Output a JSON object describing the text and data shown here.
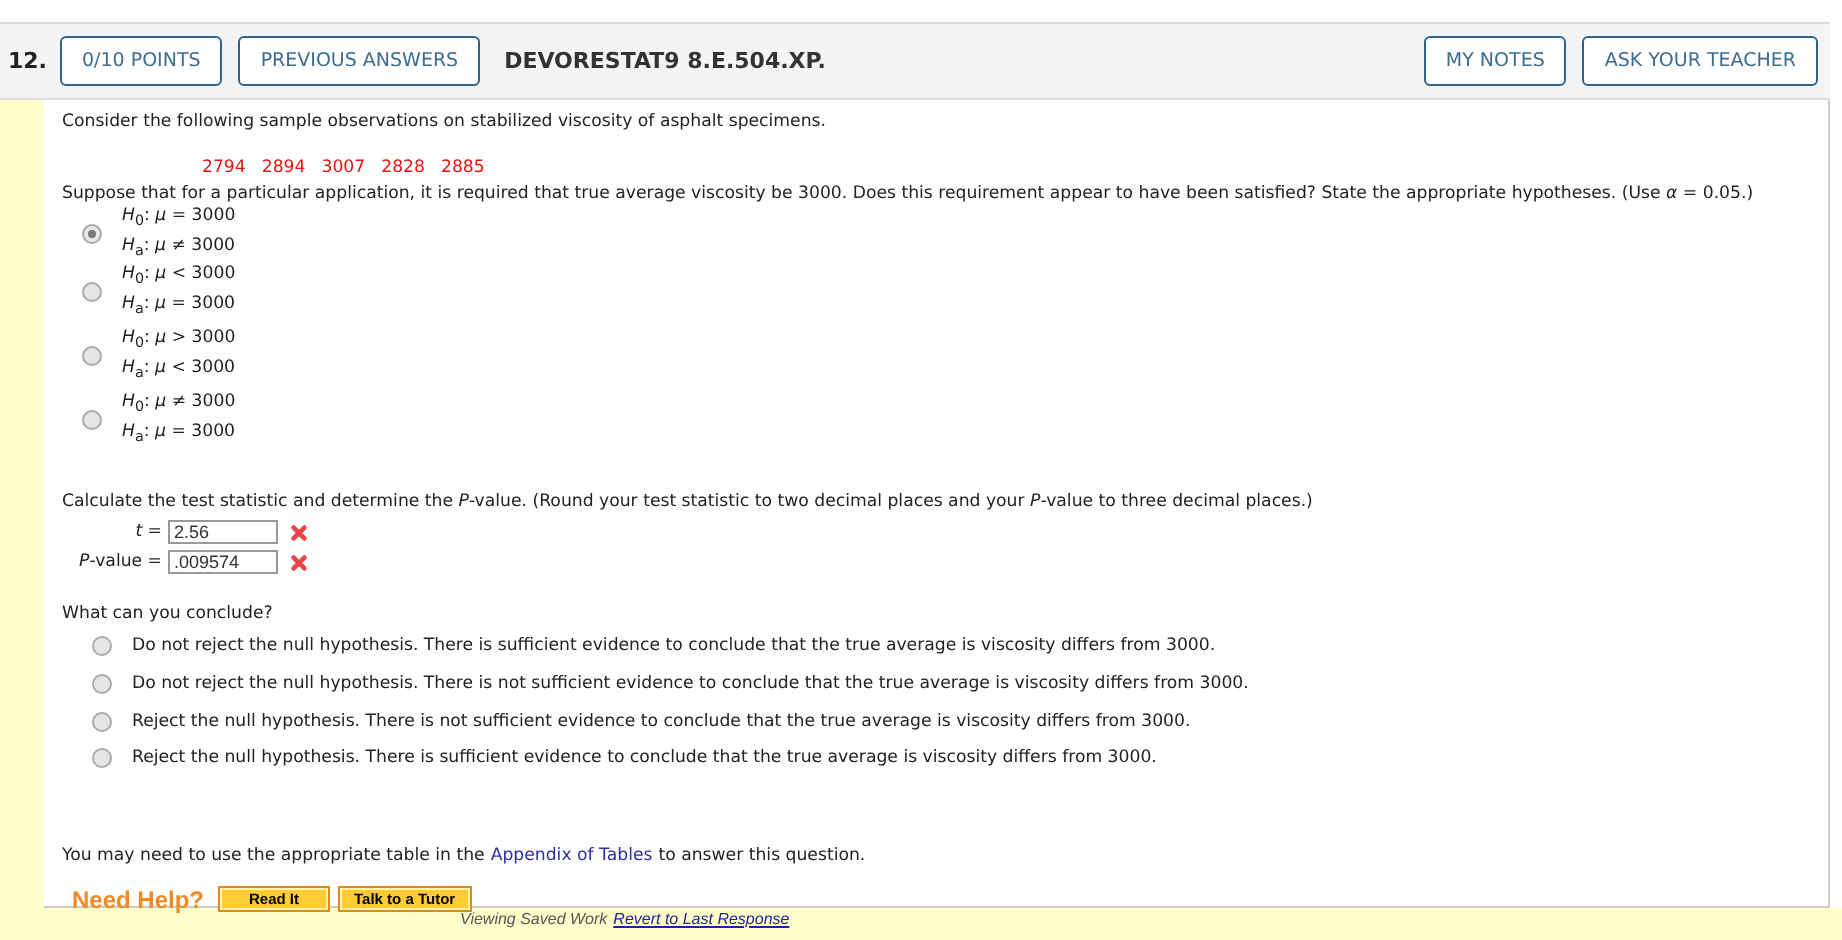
{
  "question": {
    "number": "12.",
    "points": "0/10 POINTS",
    "previous_answers": "PREVIOUS ANSWERS",
    "code": "DEVORESTAT9 8.E.504.XP.",
    "buttons": [
      "MY NOTES",
      "ASK YOUR TEACHER"
    ]
  },
  "intro": "Consider the following sample observations on stabilized viscosity of asphalt specimens.",
  "observations": [
    "2794",
    "2894",
    "3007",
    "2828",
    "2885"
  ],
  "prompt": "Suppose that for a particular application, it is required that true average viscosity be 3000. Does this requirement appear to have been satisfied? State the appropriate hypotheses. (Use *α* = 0.05.)",
  "hypothesis_options": [
    {
      "lines": [
        "*H*$_{0}$: *μ* = 3000",
        "*H*$_{a}$: *μ* ≠ 3000"
      ],
      "selected": true
    },
    {
      "lines": [
        "*H*$_{0}$: *μ* < 3000",
        "*H*$_{a}$: *μ* = 3000"
      ],
      "selected": false
    },
    {
      "lines": [
        "*H*$_{0}$: *μ* > 3000",
        "*H*$_{a}$: *μ* < 3000"
      ],
      "selected": false
    },
    {
      "lines": [
        "*H*$_{0}$: *μ* ≠ 3000",
        "*H*$_{a}$: *μ* = 3000"
      ],
      "selected": false
    }
  ],
  "calc_prompt": "Calculate the test statistic and determine the *P*-value. (Round your test statistic to two decimal places and your *P*-value to three decimal places.)",
  "answers": [
    {
      "label": "*t* =",
      "value": "2.56",
      "correct": false
    },
    {
      "label": "*P*-value =",
      "value": ".009574",
      "correct": false
    }
  ],
  "conclusion_prompt": "What can you conclude?",
  "conclusion_options": [
    {
      "text": "Do not reject the null hypothesis. There is sufficient evidence to conclude that the true average is viscosity differs from 3000.",
      "selected": false
    },
    {
      "text": "Do not reject the null hypothesis. There is not sufficient evidence to conclude that the true average is viscosity differs from 3000.",
      "selected": false
    },
    {
      "text": "Reject the null hypothesis. There is not sufficient evidence to conclude that the true average is viscosity differs from 3000.",
      "selected": false
    },
    {
      "text": "Reject the null hypothesis. There is sufficient evidence to conclude that the true average is viscosity differs from 3000.",
      "selected": false
    }
  ],
  "appendix_note": {
    "before": "You may need to use the appropriate table in the",
    "link": "Appendix of Tables",
    "after": "to answer this question."
  },
  "help": {
    "label": "Need Help?",
    "buttons": [
      "Read It",
      "Talk to a Tutor"
    ]
  },
  "footer": {
    "status": "Viewing Saved Work",
    "link": "Revert to Last Response"
  }
}
